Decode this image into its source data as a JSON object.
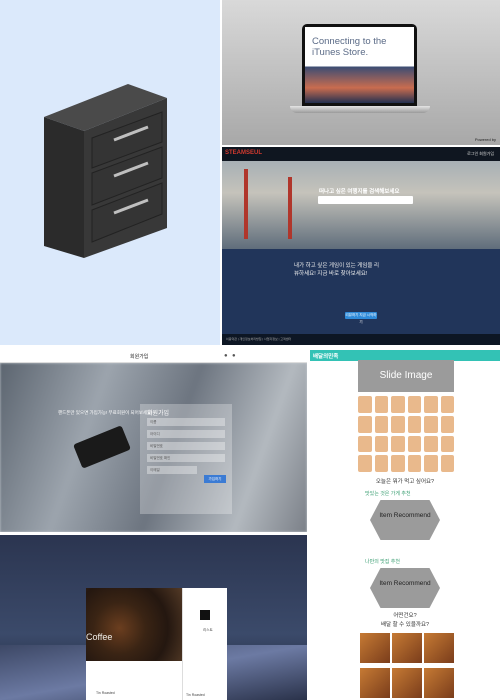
{
  "tile_laptop": {
    "heading_line1": "Connecting to the",
    "heading_line2": "iTunes Store.",
    "footer_tiny": "Powered by"
  },
  "tile_travel": {
    "logo": "STEAMSEUL",
    "nav_right": "로그인  회원가입",
    "hero_question": "떠나고 싶은 여행지를 검색해보세요",
    "search_placeholder": "여행지 검색",
    "mid_text": "내가 하고 싶은 게임이 있는 게임을 리뷰하세요! 지금 바로 찾아보세요!",
    "cta_button": "리뷰하기 지금 시작하기",
    "footer": "이용약관 | 개인정보처리방침 | 사업자정보 | 고객센터"
  },
  "tile_signup": {
    "top_title": "회원가입",
    "tagline": "핸드폰만 있으면 가입가능! 무료회원이 되어보세요!",
    "panel_title": "회원가입",
    "fields": [
      "이름",
      "아이디",
      "비밀번호",
      "비밀번호 확인",
      "이메일"
    ],
    "submit": "가입하기"
  },
  "tile_cards": {
    "coffee_caption": "Coffee",
    "card_label": "리스트",
    "card_meta_left": "Tin Roasted",
    "card_meta_right": "Tin Roasted"
  },
  "tile_food": {
    "logo": "배달의민족",
    "slide_label": "Slide Image",
    "question_today": "오늘은 뭐가 먹고 싶어요?",
    "recommend_label_1": "맛있는 것은 가게 추천",
    "item_recommend": "Item Recommend",
    "question_favorite": "나만의 맛집 추천",
    "question_location": "어떤건요?",
    "question_delivery": "배달 할 수 있을까요?"
  }
}
